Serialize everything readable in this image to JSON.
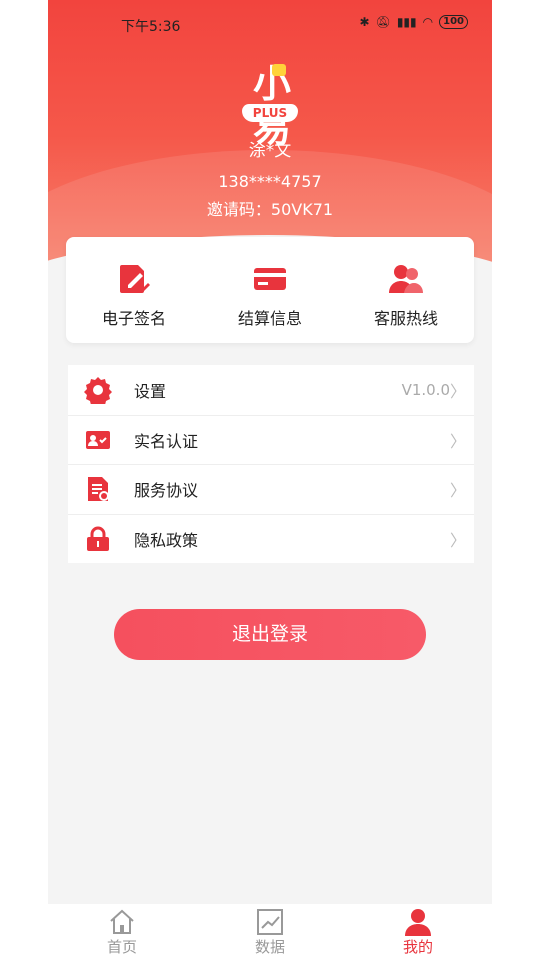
{
  "status_bar": {
    "time": "下午5:36",
    "battery": "100"
  },
  "profile": {
    "logo_text": "小易",
    "logo_badge": "PLUS",
    "name": "涂*文",
    "phone": "138****4757",
    "invite_label": "邀请码：50VK71"
  },
  "quick_actions": [
    {
      "label": "电子签名",
      "icon": "signature-icon"
    },
    {
      "label": "结算信息",
      "icon": "card-icon"
    },
    {
      "label": "客服热线",
      "icon": "service-icon"
    }
  ],
  "menu": {
    "items": [
      {
        "label": "设置",
        "value": "V1.0.0",
        "icon": "gear-icon"
      },
      {
        "label": "实名认证",
        "value": "",
        "icon": "id-card-icon"
      },
      {
        "label": "服务协议",
        "value": "",
        "icon": "document-icon"
      },
      {
        "label": "隐私政策",
        "value": "",
        "icon": "lock-icon"
      }
    ],
    "chevron": "〉"
  },
  "logout_label": "退出登录",
  "tabbar": {
    "tabs": [
      {
        "label": "首页",
        "icon": "home-icon"
      },
      {
        "label": "数据",
        "icon": "chart-icon"
      },
      {
        "label": "我的",
        "icon": "user-icon"
      }
    ],
    "active_color": "#e8343d"
  },
  "colors": {
    "brand_red": "#f2443e",
    "accent": "#f5505e",
    "icon_red": "#e8343d"
  }
}
